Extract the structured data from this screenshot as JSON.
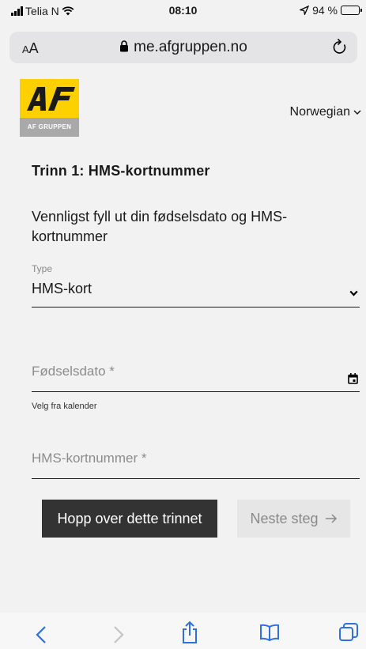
{
  "status_bar": {
    "carrier": "Telia N",
    "time": "08:10",
    "battery": "94 %",
    "battery_level": 0.94
  },
  "browser": {
    "text_size": "AA",
    "url": "me.afgruppen.no"
  },
  "logo": {
    "caption": "AF GRUPPEN"
  },
  "language": {
    "selected": "Norwegian"
  },
  "form": {
    "step_title": "Trinn 1: HMS-kortnummer",
    "instructions": "Vennligst fyll ut din fødselsdato og HMS-kortnummer",
    "type_label": "Type",
    "type_value": "HMS-kort",
    "dob_placeholder": "Fødselsdato *",
    "dob_helper": "Velg fra kalender",
    "card_placeholder": "HMS-kortnummer *"
  },
  "actions": {
    "skip_label": "Hopp over dette trinnet",
    "next_label": "Neste steg"
  },
  "toolbar": {
    "icons": [
      "back-icon",
      "forward-icon",
      "share-icon",
      "bookmarks-icon",
      "tabs-icon"
    ]
  }
}
